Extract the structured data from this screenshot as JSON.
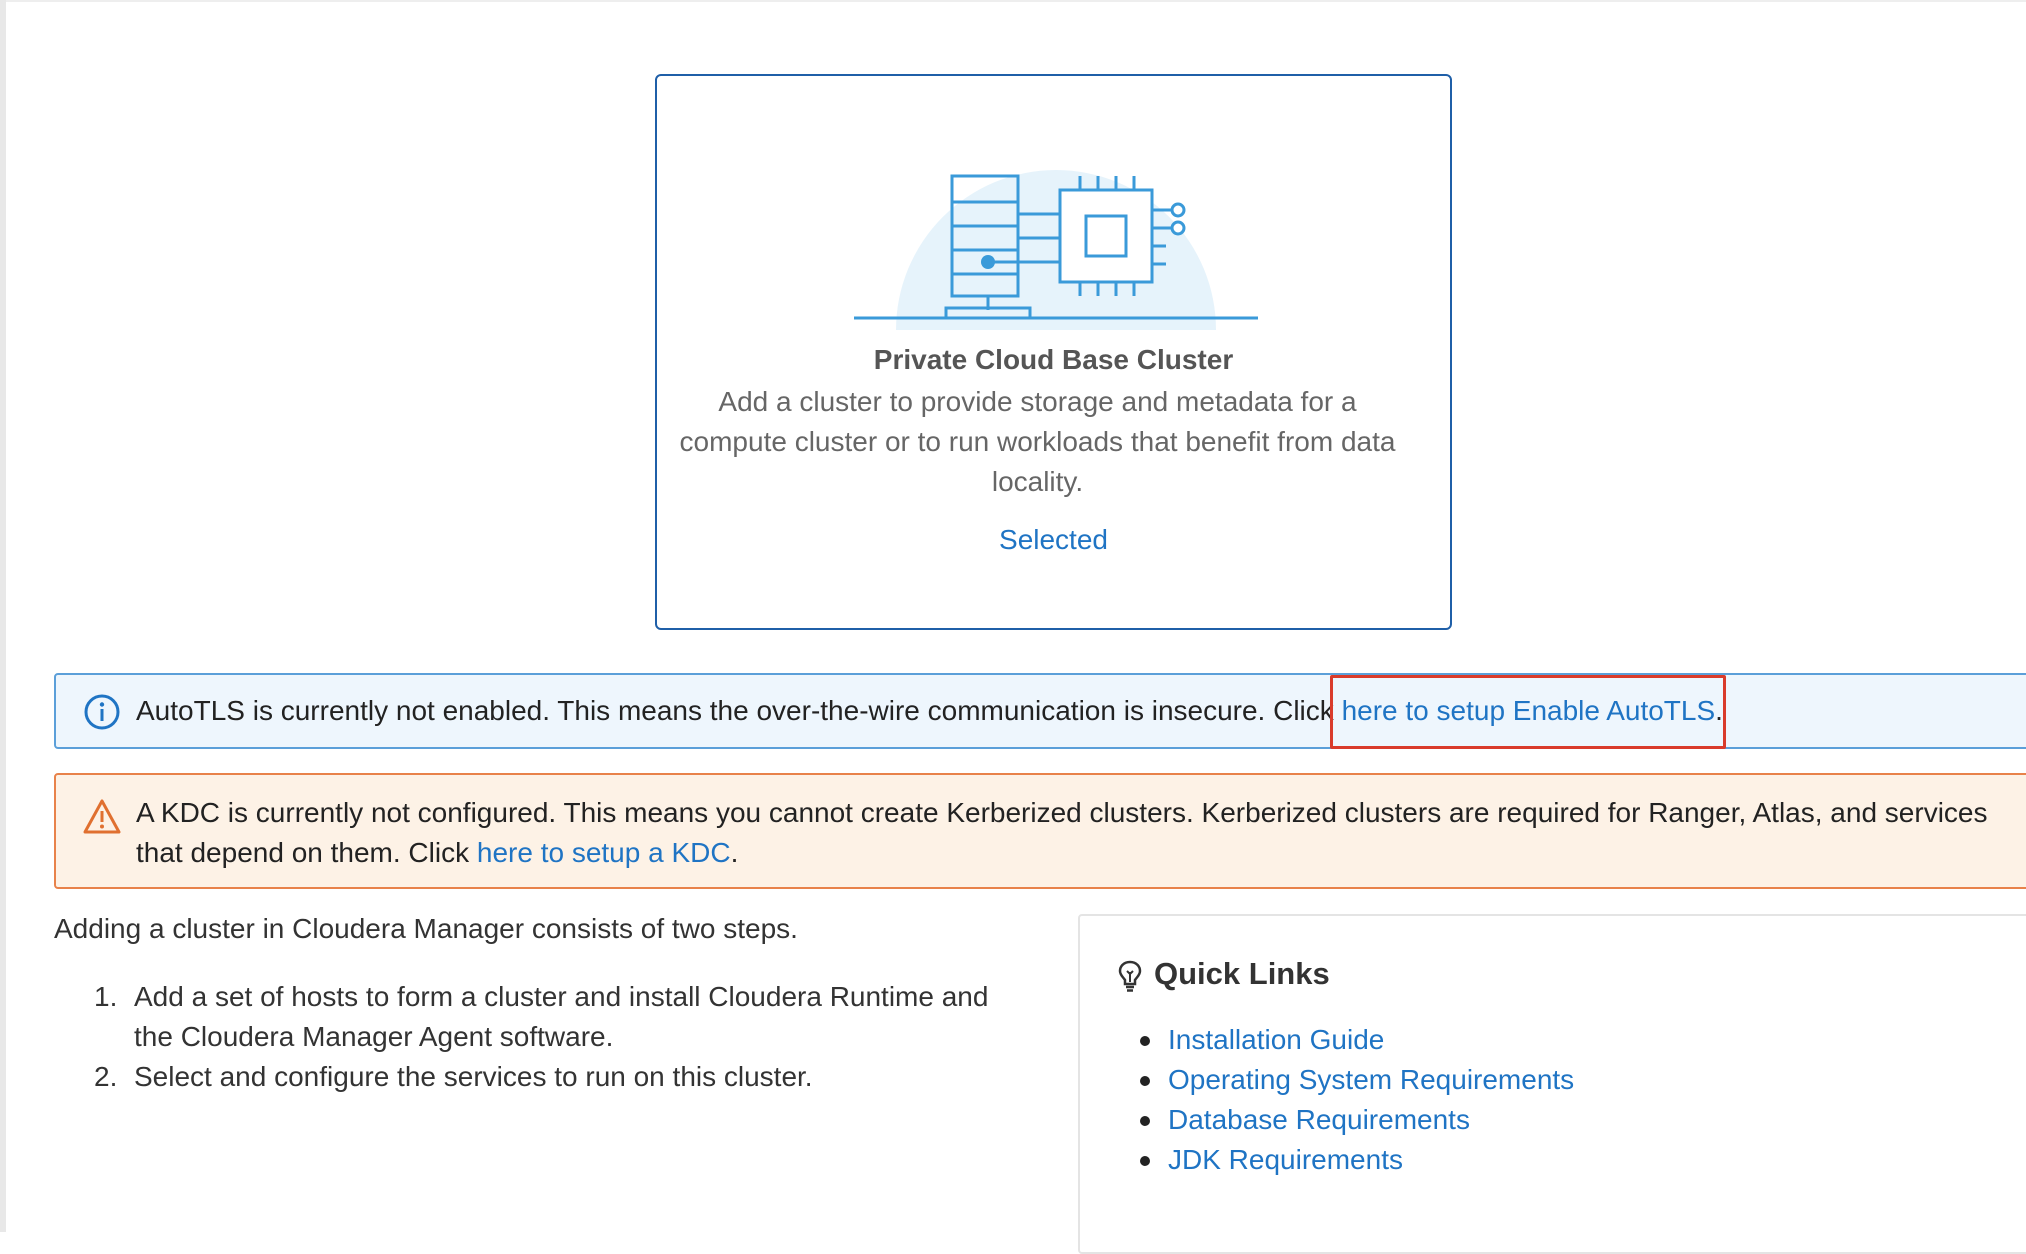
{
  "card": {
    "title": "Private Cloud Base Cluster",
    "description": "Add a cluster to provide storage and metadata for a compute cluster or to run workloads that benefit from data locality.",
    "status": "Selected",
    "illustration_icon": "server-chip-icon"
  },
  "alerts": {
    "autotls": {
      "icon": "info-icon",
      "text": "AutoTLS is currently not enabled. This means the over-the-wire communication is insecure. Click ",
      "link": "here to setup Enable AutoTLS",
      "suffix": "."
    },
    "kdc": {
      "icon": "warning-icon",
      "text": "A KDC is currently not configured. This means you cannot create Kerberized clusters. Kerberized clusters are required for Ranger, Atlas, and services that depend on them. Click ",
      "link": "here to setup a KDC",
      "suffix": "."
    }
  },
  "steps": {
    "intro": "Adding a cluster in Cloudera Manager consists of two steps.",
    "items": [
      {
        "num": "1.",
        "text": "Add a set of hosts to form a cluster and install Cloudera Runtime and the Cloudera Manager Agent software."
      },
      {
        "num": "2.",
        "text": "Select and configure the services to run on this cluster."
      }
    ]
  },
  "quick_links": {
    "icon": "lightbulb-icon",
    "title": "Quick Links",
    "items": [
      "Installation Guide",
      "Operating System Requirements",
      "Database Requirements",
      "JDK Requirements"
    ]
  },
  "colors": {
    "accent": "#1f74c4",
    "card_border": "#1f5fa8",
    "info_bg": "#eef6fd",
    "info_border": "#5b9fd9",
    "warn_bg": "#fdf2e6",
    "warn_border": "#e8824a",
    "highlight": "#d93b2b"
  }
}
